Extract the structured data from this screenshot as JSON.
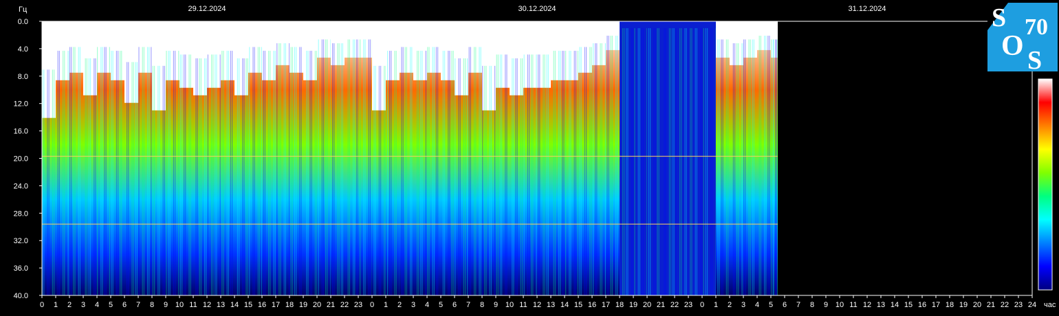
{
  "chart_data": {
    "type": "heatmap",
    "title": "",
    "ylabel": "Гц",
    "xlabel": "час",
    "ylim": [
      0,
      40
    ],
    "y_ticks": [
      "0.0",
      "4.0",
      "8.0",
      "12.0",
      "16.0",
      "20.0",
      "24.0",
      "28.0",
      "32.0",
      "36.0",
      "40.0"
    ],
    "dates": [
      "29.12.2024",
      "30.12.2024",
      "31.12.2024"
    ],
    "x_ticks": [
      "0",
      "1",
      "2",
      "3",
      "4",
      "5",
      "6",
      "7",
      "8",
      "9",
      "10",
      "11",
      "12",
      "13",
      "14",
      "15",
      "16",
      "17",
      "18",
      "19",
      "20",
      "21",
      "22",
      "23",
      "0",
      "1",
      "2",
      "3",
      "4",
      "5",
      "6",
      "7",
      "8",
      "9",
      "10",
      "11",
      "12",
      "13",
      "14",
      "15",
      "16",
      "17",
      "18",
      "19",
      "20",
      "21",
      "22",
      "23",
      "0",
      "1",
      "2",
      "3",
      "4",
      "5",
      "6",
      "7",
      "8",
      "9",
      "10",
      "11",
      "12",
      "13",
      "14",
      "15",
      "16",
      "17",
      "18",
      "19",
      "20",
      "21",
      "22",
      "23",
      "24"
    ],
    "data_end_hours": 53.5,
    "intensity_profile": [
      0.85,
      0.6,
      0.55,
      0.7,
      0.55,
      0.6,
      0.75,
      0.55,
      0.8,
      0.6,
      0.65,
      0.7,
      0.65,
      0.6,
      0.7,
      0.55,
      0.6,
      0.5,
      0.55,
      0.6,
      0.45,
      0.5,
      0.45,
      0.45,
      0.8,
      0.6,
      0.55,
      0.6,
      0.55,
      0.6,
      0.7,
      0.55,
      0.8,
      0.65,
      0.7,
      0.65,
      0.65,
      0.6,
      0.6,
      0.55,
      0.5,
      0.4,
      0.2,
      0.15,
      0.15,
      0.15,
      0.15,
      0.15,
      0.3,
      0.45,
      0.5,
      0.45,
      0.4,
      0.45
    ],
    "colorbar": [
      "#000080",
      "#0000ff",
      "#0080ff",
      "#00ffff",
      "#00ff80",
      "#80ff00",
      "#ffff00",
      "#ff8000",
      "#ff0000",
      "#ffffff"
    ],
    "resonance_lines_hz": [
      19.7,
      29.6
    ]
  },
  "logo": {
    "letters": [
      "S",
      "O",
      "S"
    ],
    "number": "70",
    "bg": "#1e9ee0"
  }
}
